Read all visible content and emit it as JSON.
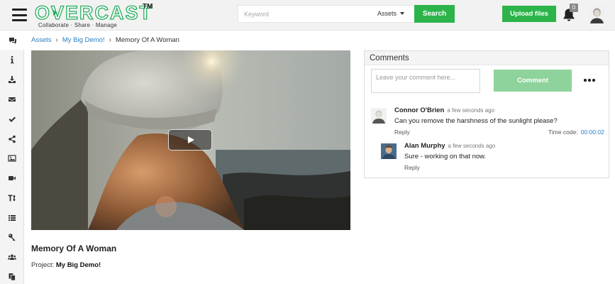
{
  "header": {
    "logo": {
      "word": "OVERCAST",
      "tm": "TM",
      "tagline": "Collaborate · Share · Manage"
    },
    "search": {
      "placeholder": "Keyword",
      "scope": "Assets",
      "button_label": "Search"
    },
    "upload_label": "Upload files",
    "notification_count": "0",
    "accent_color": "#2cb44a"
  },
  "rail": {
    "items": [
      {
        "icon": "comments-icon"
      },
      {
        "icon": "info-icon"
      },
      {
        "icon": "download-icon"
      },
      {
        "icon": "envelope-icon"
      },
      {
        "icon": "check-icon"
      },
      {
        "icon": "share-icon"
      },
      {
        "icon": "image-icon"
      },
      {
        "icon": "video-camera-icon"
      },
      {
        "icon": "text-height-icon"
      },
      {
        "icon": "list-icon"
      },
      {
        "icon": "key-icon"
      },
      {
        "icon": "users-icon"
      },
      {
        "icon": "copy-icon"
      }
    ]
  },
  "breadcrumb": {
    "items": [
      "Assets",
      "My Big Demo!"
    ],
    "current": "Memory Of A Woman"
  },
  "asset": {
    "title": "Memory Of A Woman",
    "project_label": "Project:",
    "project_name": "My Big Demo!"
  },
  "comments": {
    "heading": "Comments",
    "input_placeholder": "Leave your comment here...",
    "submit_label": "Comment",
    "list": [
      {
        "author": "Connor O'Brien",
        "time": "a few seconds ago",
        "text": "Can you remove the harshness of the sunlight please?",
        "reply_label": "Reply",
        "timecode_label": "Time code:",
        "timecode": "00:00:02"
      },
      {
        "author": "Alan Murphy",
        "time": "a few seconds ago",
        "text": "Sure - working on that now.",
        "reply_label": "Reply"
      }
    ]
  }
}
